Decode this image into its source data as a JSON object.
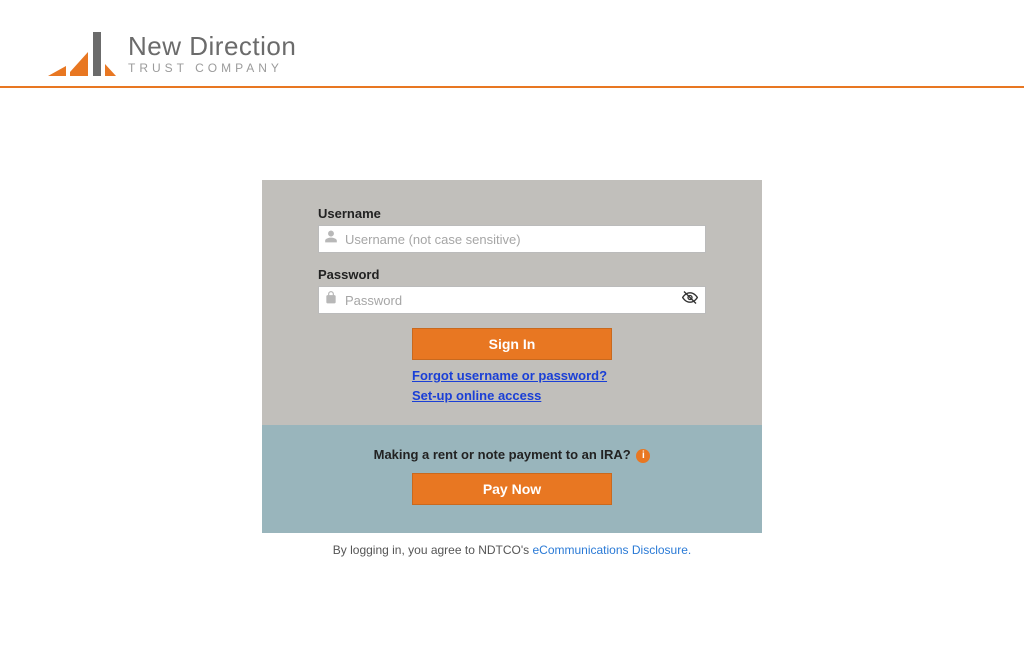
{
  "brand": {
    "name_top": "New Direction",
    "name_bottom": "TRUST COMPANY"
  },
  "form": {
    "username_label": "Username",
    "username_placeholder": "Username (not case sensitive)",
    "password_label": "Password",
    "password_placeholder": "Password",
    "signin_label": "Sign In",
    "forgot_link": "Forgot username or password?",
    "setup_link": "Set-up online access"
  },
  "payment": {
    "prompt": "Making a rent or note payment to an IRA?",
    "paynow_label": "Pay Now"
  },
  "disclaimer": {
    "prefix": "By logging in, you agree to NDTCO's ",
    "link": "eCommunications Disclosure."
  },
  "colors": {
    "accent": "#E87722"
  }
}
